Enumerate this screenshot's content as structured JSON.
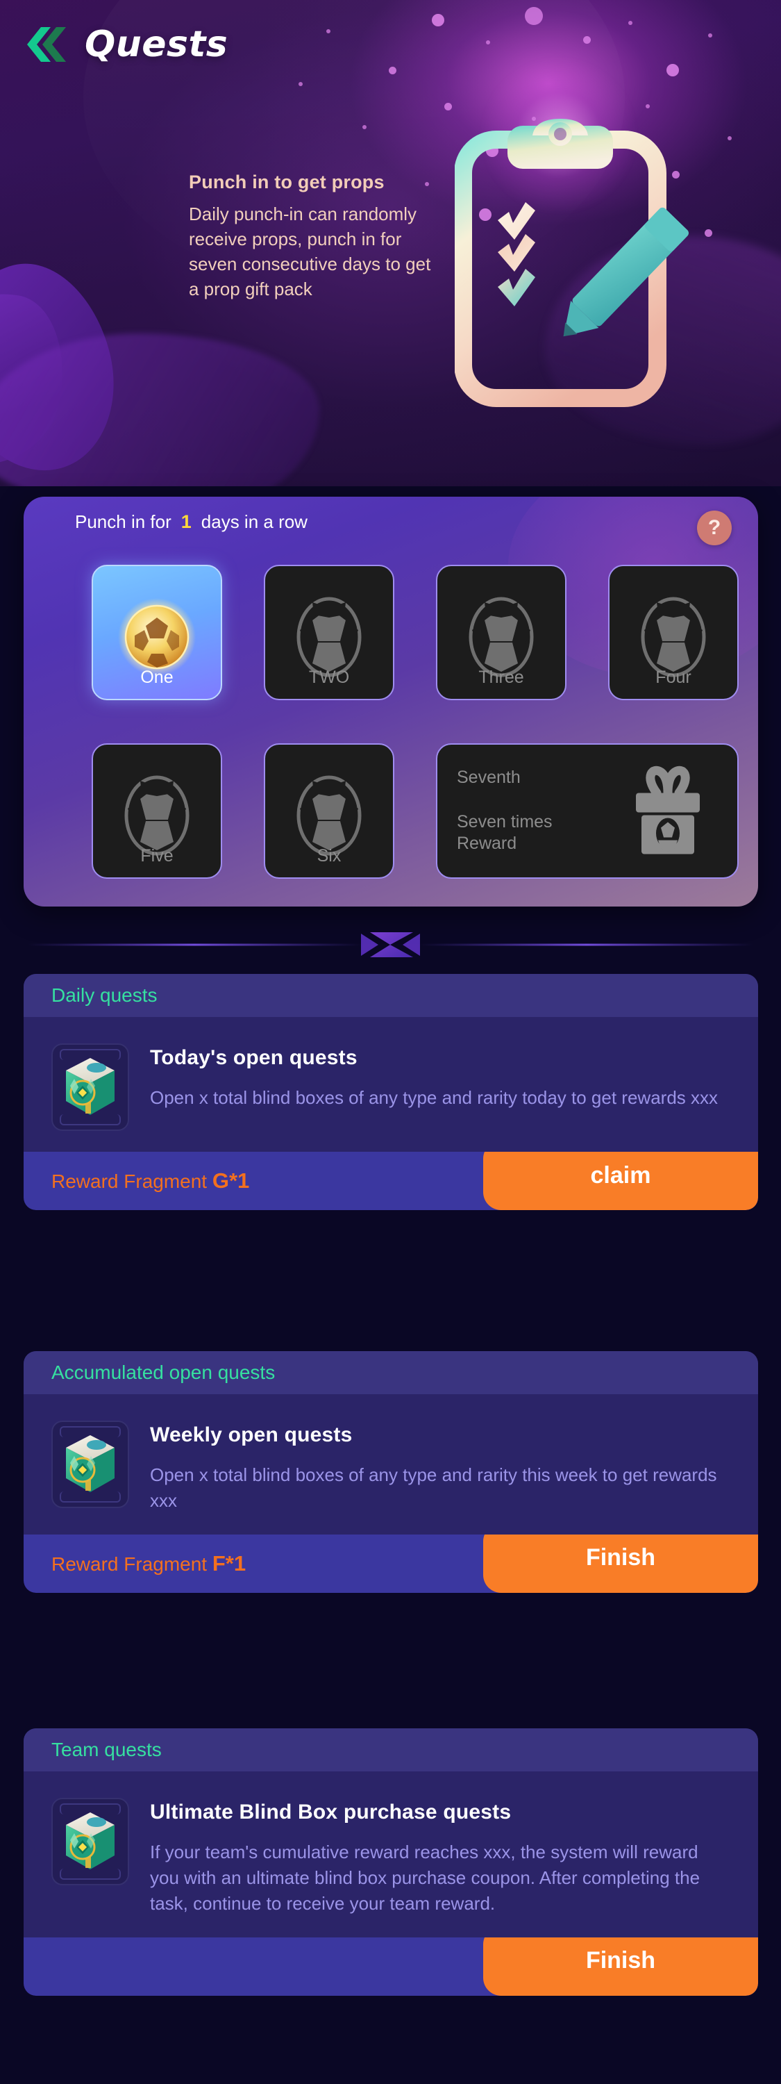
{
  "header": {
    "title": "Quests",
    "back_icon": "double-chevron-left-icon",
    "promo_title": "Punch in to get props",
    "promo_body": "Daily punch-in can randomly receive props, punch in for seven consecutive days to get a prop gift pack",
    "illustration_icon": "clipboard-with-pencil-icon"
  },
  "punch_in": {
    "label_prefix": "Punch in for",
    "count": "1",
    "label_suffix": "days in a row",
    "help_icon": "question-mark-icon",
    "days": [
      {
        "label": "One",
        "state": "active",
        "icon": "golden-soccer-ball-icon"
      },
      {
        "label": "TWO",
        "state": "inactive",
        "icon": "soccer-ball-icon"
      },
      {
        "label": "Three",
        "state": "inactive",
        "icon": "soccer-ball-icon"
      },
      {
        "label": "Four",
        "state": "inactive",
        "icon": "soccer-ball-icon"
      },
      {
        "label": "Five",
        "state": "inactive",
        "icon": "soccer-ball-icon"
      },
      {
        "label": "Six",
        "state": "inactive",
        "icon": "soccer-ball-icon"
      }
    ],
    "seventh": {
      "title": "Seventh",
      "subtitle": "Seven times\nReward",
      "subtitle_line1": "Seven times",
      "subtitle_line2": "Reward",
      "icon": "gift-box-icon"
    }
  },
  "divider": {
    "icon": "bowtie-ornament-icon"
  },
  "sections": [
    {
      "header": "Daily quests",
      "title": "Today's open quests",
      "desc": "Open x total blind boxes of any type and rarity today to get rewards xxx",
      "icon": "blind-box-icon",
      "reward_label": "Reward Fragment",
      "reward_value": "G*1",
      "action_label": "claim"
    },
    {
      "header": "Accumulated open quests",
      "title": "Weekly open quests",
      "desc": "Open x total blind boxes of any type and rarity this week to get rewards xxx",
      "icon": "blind-box-icon",
      "reward_label": "Reward Fragment",
      "reward_value": "F*1",
      "action_label": "Finish"
    },
    {
      "header": "Team quests",
      "title": "Ultimate Blind Box purchase quests",
      "desc": "If your team's cumulative reward reaches xxx, the system will reward you with an ultimate blind box purchase coupon. After completing the task, continue to receive your team reward.",
      "icon": "blind-box-icon",
      "reward_label": "",
      "reward_value": "",
      "action_label": "Finish"
    }
  ],
  "colors": {
    "page_bg": "#0a0725",
    "accent_green": "#36e0a0",
    "accent_orange": "#f97d27",
    "reward_orange": "#f3701f",
    "panel_purple": "#5134b3",
    "card_bg": "#2b2468",
    "card_header_bg": "#3a3480",
    "reward_bar_bg": "#3b37a0",
    "highlight_yellow": "#ffd93a",
    "desc_text": "#9b94e8",
    "promo_text": "#f2cfbc",
    "help_bg": "#cf7b73"
  }
}
